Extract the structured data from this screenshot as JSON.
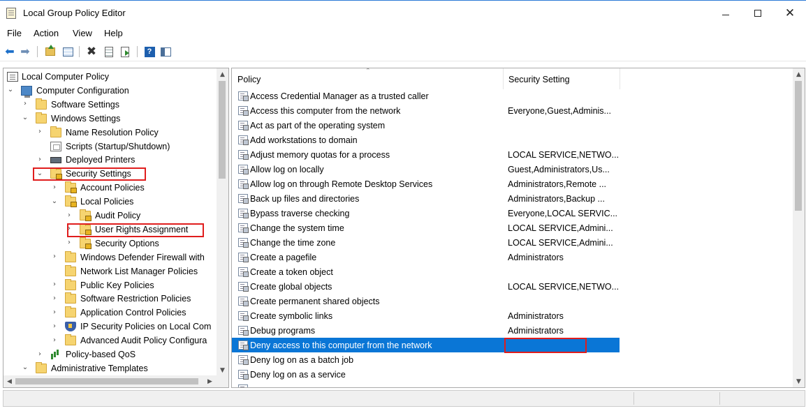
{
  "window": {
    "title": "Local Group Policy Editor"
  },
  "menu": [
    "File",
    "Action",
    "View",
    "Help"
  ],
  "toolbar": {
    "buttons": [
      "back-icon",
      "forward-icon",
      "up-folder-icon",
      "show-hide-tree-icon",
      "delete-icon",
      "properties-icon",
      "export-list-icon",
      "help-icon",
      "view-icon"
    ]
  },
  "tree": [
    {
      "label": "Local Computer Policy",
      "icon": "policy-icon",
      "toggle": ""
    },
    {
      "label": "Computer Configuration",
      "icon": "computer-icon",
      "toggle": "expanded"
    },
    {
      "label": "Software Settings",
      "icon": "folder-icon",
      "toggle": "collapsed"
    },
    {
      "label": "Windows Settings",
      "icon": "folder-icon",
      "toggle": "expanded"
    },
    {
      "label": "Name Resolution Policy",
      "icon": "folder-icon",
      "toggle": "collapsed"
    },
    {
      "label": "Scripts (Startup/Shutdown)",
      "icon": "scripts-icon",
      "toggle": ""
    },
    {
      "label": "Deployed Printers",
      "icon": "printer-icon",
      "toggle": "collapsed"
    },
    {
      "label": "Security Settings",
      "icon": "security-folder-icon",
      "toggle": "expanded"
    },
    {
      "label": "Account Policies",
      "icon": "security-folder-icon",
      "toggle": "collapsed"
    },
    {
      "label": "Local Policies",
      "icon": "security-folder-icon",
      "toggle": "expanded"
    },
    {
      "label": "Audit Policy",
      "icon": "security-folder-icon",
      "toggle": "collapsed"
    },
    {
      "label": "User Rights Assignment",
      "icon": "security-folder-icon",
      "toggle": "collapsed"
    },
    {
      "label": "Security Options",
      "icon": "security-folder-icon",
      "toggle": "collapsed"
    },
    {
      "label": "Windows Defender Firewall with",
      "icon": "folder-icon",
      "toggle": "collapsed"
    },
    {
      "label": "Network List Manager Policies",
      "icon": "folder-icon",
      "toggle": ""
    },
    {
      "label": "Public Key Policies",
      "icon": "folder-icon",
      "toggle": "collapsed"
    },
    {
      "label": "Software Restriction Policies",
      "icon": "folder-icon",
      "toggle": "collapsed"
    },
    {
      "label": "Application Control Policies",
      "icon": "folder-icon",
      "toggle": "collapsed"
    },
    {
      "label": "IP Security Policies on Local Com",
      "icon": "ip-security-icon",
      "toggle": "collapsed"
    },
    {
      "label": "Advanced Audit Policy Configura",
      "icon": "folder-icon",
      "toggle": "collapsed"
    },
    {
      "label": "Policy-based QoS",
      "icon": "qos-icon",
      "toggle": "collapsed"
    },
    {
      "label": "Administrative Templates",
      "icon": "folder-icon",
      "toggle": "expanded"
    }
  ],
  "list": {
    "columns": [
      "Policy",
      "Security Setting"
    ],
    "rows": [
      {
        "policy": "Access Credential Manager as a trusted caller",
        "setting": ""
      },
      {
        "policy": "Access this computer from the network",
        "setting": "Everyone,Guest,Adminis..."
      },
      {
        "policy": "Act as part of the operating system",
        "setting": ""
      },
      {
        "policy": "Add workstations to domain",
        "setting": ""
      },
      {
        "policy": "Adjust memory quotas for a process",
        "setting": "LOCAL SERVICE,NETWO..."
      },
      {
        "policy": "Allow log on locally",
        "setting": "Guest,Administrators,Us..."
      },
      {
        "policy": "Allow log on through Remote Desktop Services",
        "setting": "Administrators,Remote ..."
      },
      {
        "policy": "Back up files and directories",
        "setting": "Administrators,Backup ..."
      },
      {
        "policy": "Bypass traverse checking",
        "setting": "Everyone,LOCAL SERVIC..."
      },
      {
        "policy": "Change the system time",
        "setting": "LOCAL SERVICE,Admini..."
      },
      {
        "policy": "Change the time zone",
        "setting": "LOCAL SERVICE,Admini..."
      },
      {
        "policy": "Create a pagefile",
        "setting": "Administrators"
      },
      {
        "policy": "Create a token object",
        "setting": ""
      },
      {
        "policy": "Create global objects",
        "setting": "LOCAL SERVICE,NETWO..."
      },
      {
        "policy": "Create permanent shared objects",
        "setting": ""
      },
      {
        "policy": "Create symbolic links",
        "setting": "Administrators"
      },
      {
        "policy": "Debug programs",
        "setting": "Administrators"
      },
      {
        "policy": "Deny access to this computer from the network",
        "setting": "",
        "selected": true
      },
      {
        "policy": "Deny log on as a batch job",
        "setting": ""
      },
      {
        "policy": "Deny log on as a service",
        "setting": ""
      },
      {
        "policy": "",
        "setting": ""
      }
    ]
  },
  "colors": {
    "selection": "#0a76d6",
    "highlight_border": "#e01d1d"
  }
}
